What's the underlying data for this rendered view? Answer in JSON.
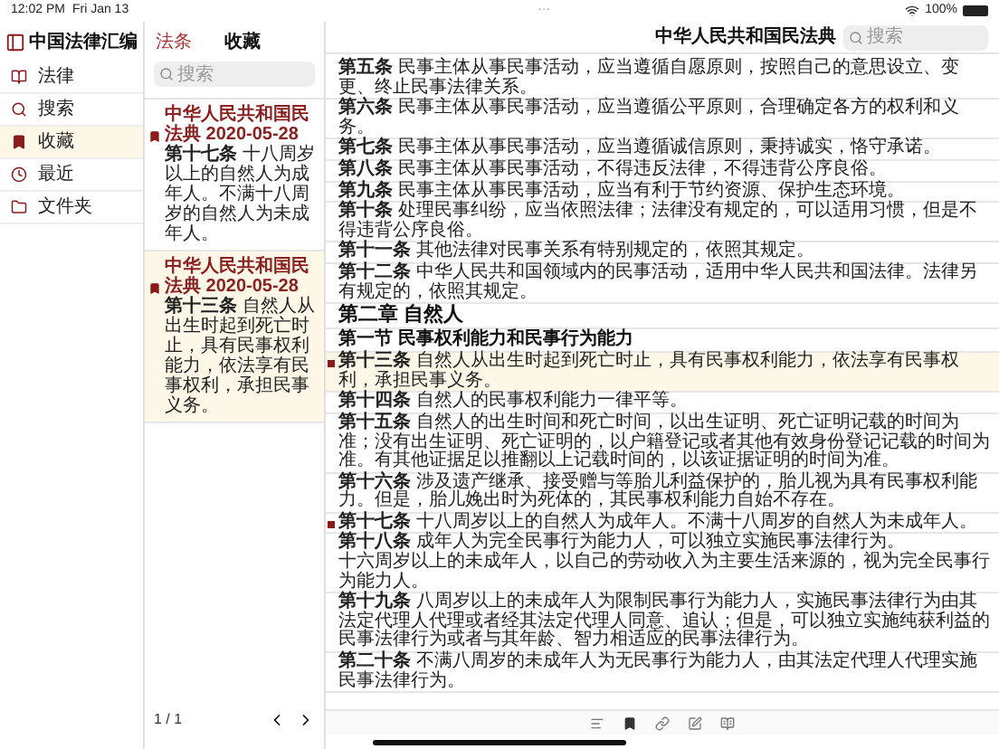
{
  "status_bar": {
    "time": "12:02 PM",
    "date": "Fri Jan 13",
    "battery": "100%",
    "multitask": "···"
  },
  "sidebar": {
    "title": "中国法律汇编",
    "items": [
      {
        "label": "法律",
        "selected": false
      },
      {
        "label": "搜索",
        "selected": false
      },
      {
        "label": "收藏",
        "selected": true
      },
      {
        "label": "最近",
        "selected": false
      },
      {
        "label": "文件夹",
        "selected": false
      }
    ]
  },
  "favorites": {
    "back": "法条",
    "title": "收藏",
    "search": {
      "placeholder": "搜索"
    },
    "items": [
      {
        "source": "中华人民共和国民法典 2020-05-28",
        "text": "**第十七条** 十八周岁以上的自然人为成年人。不满十八周岁的自然人为未成年人。",
        "selected": false
      },
      {
        "source": "中华人民共和国民法典 2020-05-28",
        "text": "**第十三条** 自然人从出生时起到死亡时止，具有民事权利能力，依法享有民事权利，承担民事义务。",
        "selected": true
      }
    ],
    "page": "1 / 1"
  },
  "document": {
    "title": "中华人民共和国民法典",
    "search": {
      "placeholder": "搜索"
    },
    "paragraphs": [
      {
        "kind": "article",
        "text": "**第五条** 民事主体从事民事活动，应当遵循自愿原则，按照自己的意思设立、变更、终止民事法律关系。",
        "bookmarked": false,
        "selected": false
      },
      {
        "kind": "article",
        "text": "**第六条** 民事主体从事民事活动，应当遵循公平原则，合理确定各方的权利和义务。",
        "bookmarked": false,
        "selected": false
      },
      {
        "kind": "article",
        "text": "**第七条** 民事主体从事民事活动，应当遵循诚信原则，秉持诚实，恪守承诺。",
        "bookmarked": false,
        "selected": false
      },
      {
        "kind": "article",
        "text": "**第八条** 民事主体从事民事活动，不得违反法律，不得违背公序良俗。",
        "bookmarked": false,
        "selected": false
      },
      {
        "kind": "article",
        "text": "**第九条** 民事主体从事民事活动，应当有利于节约资源、保护生态环境。",
        "bookmarked": false,
        "selected": false
      },
      {
        "kind": "article",
        "text": "**第十条** 处理民事纠纷，应当依照法律；法律没有规定的，可以适用习惯，但是不得违背公序良俗。",
        "bookmarked": false,
        "selected": false
      },
      {
        "kind": "article",
        "text": "**第十一条** 其他法律对民事关系有特别规定的，依照其规定。",
        "bookmarked": false,
        "selected": false
      },
      {
        "kind": "article",
        "text": "**第十二条** 中华人民共和国领域内的民事活动，适用中华人民共和国法律。法律另有规定的，依照其规定。",
        "bookmarked": false,
        "selected": false
      },
      {
        "kind": "chapter",
        "text": "第二章 自然人",
        "bookmarked": false,
        "selected": false
      },
      {
        "kind": "section",
        "text": "第一节 民事权利能力和民事行为能力",
        "bookmarked": false,
        "selected": false
      },
      {
        "kind": "article",
        "text": "**第十三条** 自然人从出生时起到死亡时止，具有民事权利能力，依法享有民事权利，承担民事义务。",
        "bookmarked": true,
        "selected": true
      },
      {
        "kind": "article",
        "text": "**第十四条** 自然人的民事权利能力一律平等。",
        "bookmarked": false,
        "selected": false
      },
      {
        "kind": "article",
        "text": "**第十五条** 自然人的出生时间和死亡时间，以出生证明、死亡证明记载的时间为准；没有出生证明、死亡证明的，以户籍登记或者其他有效身份登记记载的时间为准。有其他证据足以推翻以上记载时间的，以该证据证明的时间为准。",
        "bookmarked": false,
        "selected": false
      },
      {
        "kind": "article",
        "text": "**第十六条** 涉及遗产继承、接受赠与等胎儿利益保护的，胎儿视为具有民事权利能力。但是，胎儿娩出时为死体的，其民事权利能力自始不存在。",
        "bookmarked": false,
        "selected": false
      },
      {
        "kind": "article",
        "text": "**第十七条** 十八周岁以上的自然人为成年人。不满十八周岁的自然人为未成年人。",
        "bookmarked": true,
        "selected": false
      },
      {
        "kind": "article",
        "text": "**第十八条** 成年人为完全民事行为能力人，可以独立实施民事法律行为。",
        "text_2": "十六周岁以上的未成年人，以自己的劳动收入为主要生活来源的，视为完全民事行为能力人。",
        "bookmarked": false,
        "selected": false
      },
      {
        "kind": "article",
        "text": "**第十九条** 八周岁以上的未成年人为限制民事行为能力人，实施民事法律行为由其法定代理人代理或者经其法定代理人同意、追认；但是，可以独立实施纯获利益的民事法律行为或者与其年龄、智力相适应的民事法律行为。",
        "bookmarked": false,
        "selected": false
      },
      {
        "kind": "article",
        "text": "**第二十条** 不满八周岁的未成年人为无民事行为能力人，由其法定代理人代理实施民事法律行为。",
        "bookmarked": false,
        "selected": false
      }
    ]
  }
}
